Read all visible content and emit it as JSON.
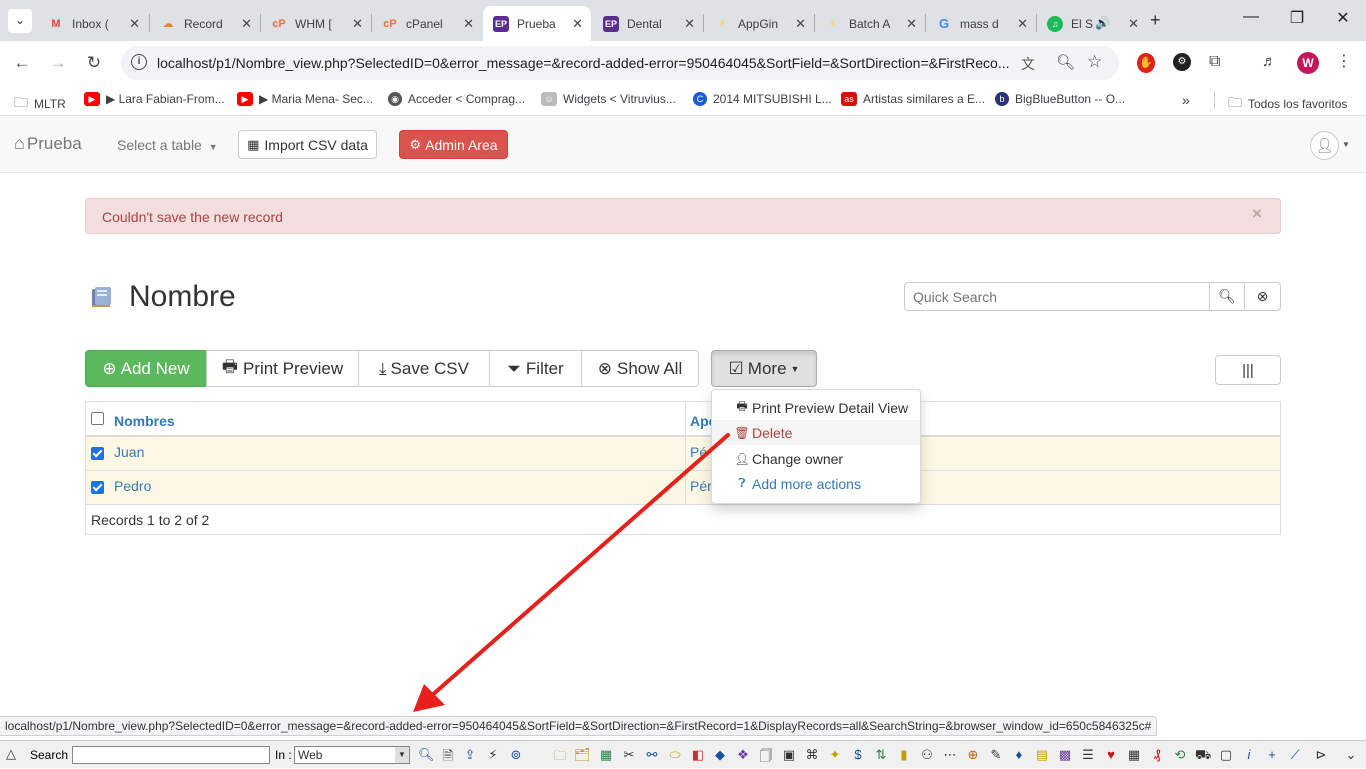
{
  "browser": {
    "tabs": [
      {
        "label": "Inbox (",
        "icon": "gmail-icon",
        "color": "#ea4335",
        "glyph": "M"
      },
      {
        "label": "Record",
        "icon": "cloudflare-icon",
        "color": "#f38020",
        "glyph": "☁"
      },
      {
        "label": "WHM [",
        "icon": "cpanel-icon",
        "color": "#ff6c2c",
        "glyph": "cP"
      },
      {
        "label": "cPanel",
        "icon": "cpanel-icon",
        "color": "#ff6c2c",
        "glyph": "cP"
      },
      {
        "label": "Prueba",
        "icon": "appgini-ep-icon",
        "color": "#5b2d90",
        "glyph": "EP",
        "active": true
      },
      {
        "label": "Dental",
        "icon": "appgini-ep-icon",
        "color": "#5b2d90",
        "glyph": "EP"
      },
      {
        "label": "AppGin",
        "icon": "lightning-icon",
        "color": "#f9d71c",
        "glyph": "⚡"
      },
      {
        "label": "Batch A",
        "icon": "lightning-icon",
        "color": "#f9d71c",
        "glyph": "⚡"
      },
      {
        "label": "mass d",
        "icon": "google-icon",
        "color": "#4285f4",
        "glyph": "G"
      },
      {
        "label": "El S",
        "icon": "spotify-icon",
        "color": "#1db954",
        "glyph": "♫"
      }
    ],
    "url": "localhost/p1/Nombre_view.php?SelectedID=0&error_message=&record-added-error=950464045&SortField=&SortDirection=&FirstReco...",
    "profile_initial": "W",
    "bookmarks": [
      {
        "label": "MLTR",
        "icon": "folder-icon"
      },
      {
        "label": "▶ Lara Fabian-From...",
        "icon": "youtube-icon"
      },
      {
        "label": "▶ Maria Mena- Sec...",
        "icon": "youtube-icon"
      },
      {
        "label": "Acceder < Comprag...",
        "icon": "globe-icon"
      },
      {
        "label": "Widgets < Vitruvius...",
        "icon": "vitruvius-icon"
      },
      {
        "label": "2014 MITSUBISHI L...",
        "icon": "mitsubishi-icon"
      },
      {
        "label": "Artistas similares a E...",
        "icon": "lastfm-icon"
      },
      {
        "label": "BigBlueButton -- O...",
        "icon": "bigbluebutton-icon"
      }
    ],
    "all_bookmarks": "Todos los favoritos"
  },
  "app": {
    "brand": "Prueba",
    "select_table": "Select a table",
    "import_csv": "Import CSV data",
    "admin_area": "Admin Area"
  },
  "alert": {
    "message": "Couldn't save the new record",
    "close": "×"
  },
  "page": {
    "title": "Nombre",
    "search_placeholder": "Quick Search"
  },
  "actions": {
    "add_new": "Add New",
    "print_preview": "Print Preview",
    "save_csv": "Save CSV",
    "filter": "Filter",
    "show_all": "Show All",
    "more": "More"
  },
  "table": {
    "columns": [
      "Nombres",
      "Ape"
    ],
    "rows": [
      {
        "nombres": "Juan",
        "apellido": "Pé"
      },
      {
        "nombres": "Pedro",
        "apellido": "Pér"
      }
    ],
    "footer": "Records 1 to 2 of 2"
  },
  "dropdown": {
    "items": [
      {
        "label": "Print Preview Detail View",
        "icon": "print-icon"
      },
      {
        "label": "Delete",
        "icon": "trash-icon"
      },
      {
        "label": "Change owner",
        "icon": "user-icon"
      },
      {
        "label": "Add more actions",
        "icon": "question-circle-icon"
      }
    ]
  },
  "status_url": "localhost/p1/Nombre_view.php?SelectedID=0&error_message=&record-added-error=950464045&SortField=&SortDirection=&FirstRecord=1&DisplayRecords=all&SearchString=&browser_window_id=650c5846325c#",
  "bottombar": {
    "search_label": "Search :",
    "in_label": "In :",
    "in_value": "Web"
  },
  "colors": {
    "success": "#5cb85c",
    "danger": "#d9534f",
    "link": "#337ab7",
    "highlight_row": "#fcf8e3",
    "annotation_arrow": "#e8201c"
  }
}
